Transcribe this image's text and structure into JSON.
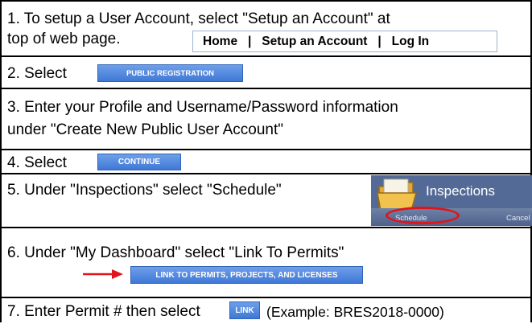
{
  "steps": [
    {
      "line1": "1.  To setup a User Account, select \"Setup an Account\" at",
      "line2": "top of web page."
    },
    {
      "text": "2.  Select"
    },
    {
      "line1": "3.  Enter your Profile and Username/Password information",
      "line2": "under \"Create New Public User Account\""
    },
    {
      "text": "4.  Select"
    },
    {
      "text": "5.  Under \"Inspections\" select \"Schedule\""
    },
    {
      "text": "6.  Under \"My Dashboard\" select \"Link To Permits\""
    },
    {
      "text": "7.  Enter Permit # then select",
      "suffix": "(Example: BRES2018-0000)"
    }
  ],
  "nav": {
    "home": "Home",
    "setup": "Setup an Account",
    "login": "Log In",
    "separator": "|"
  },
  "buttons": {
    "public_registration": "PUBLIC REGISTRATION",
    "continue": "CONTINUE",
    "link_to_permits": "LINK TO PERMITS, PROJECTS, AND LICENSES",
    "link": "LINK"
  },
  "inspections": {
    "title": "Inspections",
    "schedule": "Schedule",
    "cancel": "Cancel"
  },
  "colors": {
    "button_blue": "#3f78d6",
    "highlight_red": "#e0141a",
    "panel_blue": "#546a96"
  },
  "icons": [
    "folder-icon",
    "arrow-right-icon"
  ]
}
